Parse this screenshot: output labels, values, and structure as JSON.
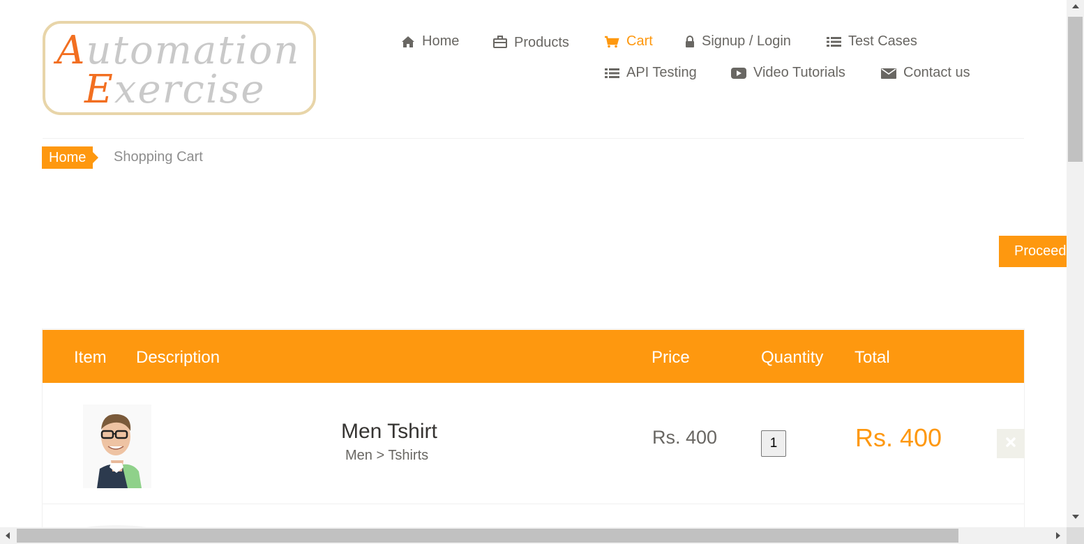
{
  "logo": {
    "line1_cap": "A",
    "line1_rest": "utomation",
    "line2_cap": "E",
    "line2_rest": "xercise"
  },
  "nav": {
    "home": "Home",
    "products": "Products",
    "cart": "Cart",
    "signup_login": "Signup / Login",
    "test_cases": "Test Cases",
    "api_testing": "API Testing",
    "video_tutorials": "Video Tutorials",
    "contact_us": "Contact us"
  },
  "breadcrumb": {
    "home": "Home",
    "current": "Shopping Cart"
  },
  "actions": {
    "proceed": "Proceed"
  },
  "table": {
    "headers": {
      "item": "Item",
      "description": "Description",
      "price": "Price",
      "quantity": "Quantity",
      "total": "Total"
    },
    "rows": [
      {
        "name": "Men Tshirt",
        "category": "Men > Tshirts",
        "price": "Rs. 400",
        "quantity": "1",
        "total": "Rs. 400"
      }
    ]
  },
  "colors": {
    "accent": "#fe980f",
    "text": "#696763",
    "heading": "#363432"
  },
  "icons": [
    "home-icon",
    "briefcase-icon",
    "shopping-cart-icon",
    "lock-icon",
    "list-icon",
    "play-icon",
    "envelope-icon",
    "close-icon"
  ]
}
